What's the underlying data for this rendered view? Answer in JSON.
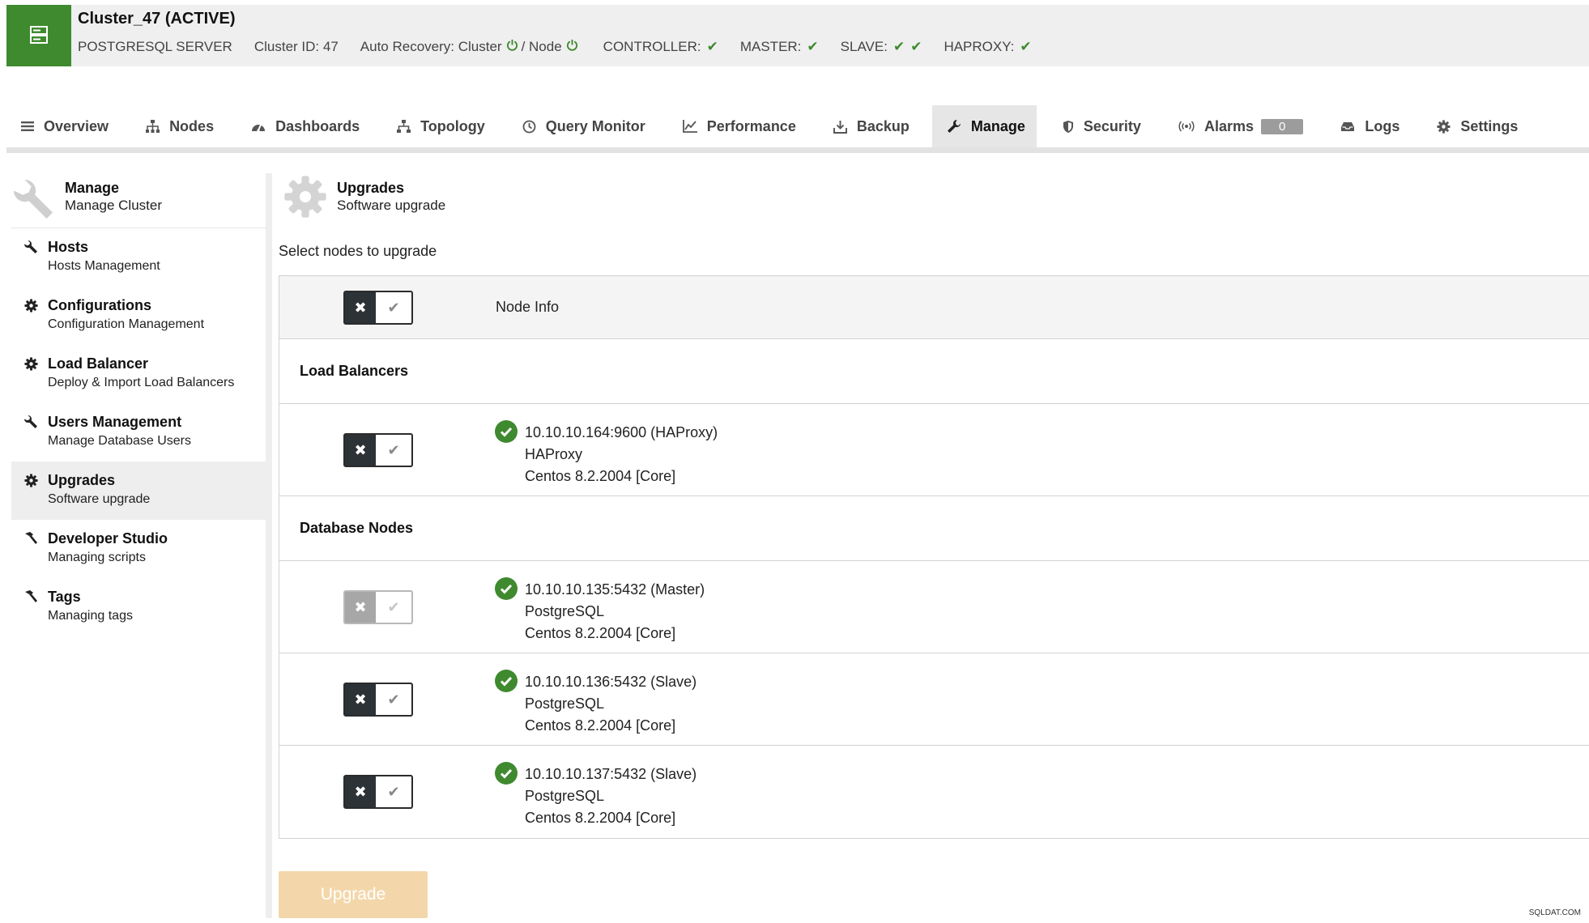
{
  "header": {
    "cluster_title": "Cluster_47 (ACTIVE)",
    "server_type": "POSTGRESQL SERVER",
    "cluster_id": "Cluster ID: 47",
    "auto_recovery_label": "Auto Recovery: Cluster",
    "node_label": "/ Node",
    "controller": "CONTROLLER:",
    "master": "MASTER:",
    "slave": "SLAVE:",
    "haproxy": "HAPROXY:",
    "accent_color": "#3f8a2f"
  },
  "tabs": [
    {
      "label": "Overview",
      "icon": "menu-icon"
    },
    {
      "label": "Nodes",
      "icon": "nodes-icon"
    },
    {
      "label": "Dashboards",
      "icon": "dashboard-icon"
    },
    {
      "label": "Topology",
      "icon": "topology-icon"
    },
    {
      "label": "Query Monitor",
      "icon": "query-monitor-icon"
    },
    {
      "label": "Performance",
      "icon": "performance-icon"
    },
    {
      "label": "Backup",
      "icon": "backup-icon"
    },
    {
      "label": "Manage",
      "icon": "wrench-icon",
      "active": true
    },
    {
      "label": "Security",
      "icon": "shield-icon"
    },
    {
      "label": "Alarms",
      "icon": "alarm-icon",
      "badge": "0"
    },
    {
      "label": "Logs",
      "icon": "logs-icon"
    },
    {
      "label": "Settings",
      "icon": "gear-icon"
    }
  ],
  "sidebar": {
    "head_title": "Manage",
    "head_subtitle": "Manage Cluster",
    "items": [
      {
        "title": "Hosts",
        "subtitle": "Hosts Management",
        "icon": "wrench-icon"
      },
      {
        "title": "Configurations",
        "subtitle": "Configuration Management",
        "icon": "gear-icon"
      },
      {
        "title": "Load Balancer",
        "subtitle": "Deploy & Import Load Balancers",
        "icon": "gear-icon"
      },
      {
        "title": "Users Management",
        "subtitle": "Manage Database Users",
        "icon": "wrench-icon"
      },
      {
        "title": "Upgrades",
        "subtitle": "Software upgrade",
        "icon": "gear-icon",
        "active": true
      },
      {
        "title": "Developer Studio",
        "subtitle": "Managing scripts",
        "icon": "hammer-icon"
      },
      {
        "title": "Tags",
        "subtitle": "Managing tags",
        "icon": "hammer-icon"
      }
    ]
  },
  "main": {
    "title": "Upgrades",
    "subtitle": "Software upgrade",
    "select_label": "Select nodes to upgrade",
    "node_info_label": "Node Info",
    "section_load_balancers": "Load Balancers",
    "section_database_nodes": "Database Nodes",
    "load_balancers": [
      {
        "address": "10.10.10.164:9600 (HAProxy)",
        "type": "HAProxy",
        "os": "Centos 8.2.2004 [Core]"
      }
    ],
    "database_nodes": [
      {
        "address": "10.10.10.135:5432 (Master)",
        "type": "PostgreSQL",
        "os": "Centos 8.2.2004 [Core]",
        "disabled": true
      },
      {
        "address": "10.10.10.136:5432 (Slave)",
        "type": "PostgreSQL",
        "os": "Centos 8.2.2004 [Core]"
      },
      {
        "address": "10.10.10.137:5432 (Slave)",
        "type": "PostgreSQL",
        "os": "Centos 8.2.2004 [Core]"
      }
    ],
    "upgrade_button": "Upgrade",
    "toggle_x": "✖",
    "toggle_check": "✔"
  },
  "watermark": "SQLDAT.COM"
}
